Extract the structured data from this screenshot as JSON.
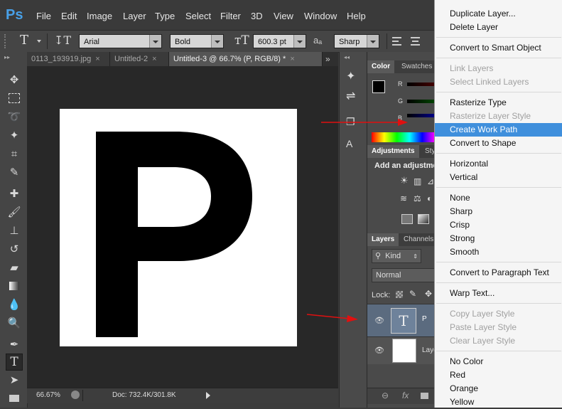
{
  "app": {
    "logo": "Ps"
  },
  "menu": [
    "File",
    "Edit",
    "Image",
    "Layer",
    "Type",
    "Select",
    "Filter",
    "3D",
    "View",
    "Window",
    "Help"
  ],
  "options": {
    "type_tool_glyph": "T",
    "font_family": "Arial",
    "font_style": "Bold",
    "font_size": "600.3 pt",
    "aa_icon": "aₐ",
    "antialias": "Sharp"
  },
  "tabs": [
    {
      "label": "0113_193919.jpg",
      "active": false
    },
    {
      "label": "Untitled-2",
      "active": false
    },
    {
      "label": "Untitled-3 @ 66.7% (P, RGB/8) *",
      "active": true
    }
  ],
  "tab_overflow": "»",
  "canvas": {
    "letter": "P"
  },
  "status": {
    "zoom": "66.67%",
    "doc": "Doc: 732.4K/301.8K"
  },
  "panels": {
    "color_tabs": [
      "Color",
      "Swatches"
    ],
    "rgb_labels": [
      "R",
      "G",
      "B"
    ],
    "adjust_tabs": [
      "Adjustments",
      "Sty"
    ],
    "adjust_hint": "Add an adjustme",
    "layers_tabs": [
      "Layers",
      "Channels"
    ],
    "kind_label": "Kind",
    "blend_mode": "Normal",
    "lock_label": "Lock:",
    "layers": [
      {
        "name": "P",
        "type": "text",
        "thumb_glyph": "T"
      },
      {
        "name": "Laye",
        "type": "raster"
      }
    ]
  },
  "context_menu": {
    "items": [
      {
        "label": "Duplicate Layer...",
        "enabled": true
      },
      {
        "label": "Delete Layer",
        "enabled": true
      },
      {
        "sep": true
      },
      {
        "label": "Convert to Smart Object",
        "enabled": true
      },
      {
        "sep": true
      },
      {
        "label": "Link Layers",
        "enabled": false
      },
      {
        "label": "Select Linked Layers",
        "enabled": false
      },
      {
        "sep": true
      },
      {
        "label": "Rasterize Type",
        "enabled": true
      },
      {
        "label": "Rasterize Layer Style",
        "enabled": false
      },
      {
        "label": "Create Work Path",
        "enabled": true,
        "highlighted": true
      },
      {
        "label": "Convert to Shape",
        "enabled": true
      },
      {
        "sep": true
      },
      {
        "label": "Horizontal",
        "enabled": true
      },
      {
        "label": "Vertical",
        "enabled": true
      },
      {
        "sep": true
      },
      {
        "label": "None",
        "enabled": true
      },
      {
        "label": "Sharp",
        "enabled": true
      },
      {
        "label": "Crisp",
        "enabled": true
      },
      {
        "label": "Strong",
        "enabled": true
      },
      {
        "label": "Smooth",
        "enabled": true
      },
      {
        "sep": true
      },
      {
        "label": "Convert to Paragraph Text",
        "enabled": true
      },
      {
        "sep": true
      },
      {
        "label": "Warp Text...",
        "enabled": true
      },
      {
        "sep": true
      },
      {
        "label": "Copy Layer Style",
        "enabled": false
      },
      {
        "label": "Paste Layer Style",
        "enabled": false
      },
      {
        "label": "Clear Layer Style",
        "enabled": false
      },
      {
        "sep": true
      },
      {
        "label": "No Color",
        "enabled": true
      },
      {
        "label": "Red",
        "enabled": true
      },
      {
        "label": "Orange",
        "enabled": true
      },
      {
        "label": "Yellow",
        "enabled": true
      }
    ]
  },
  "colors": {
    "highlight": "#3f8fdc",
    "arrow": "#e01010",
    "logo": "#48a0e8"
  }
}
